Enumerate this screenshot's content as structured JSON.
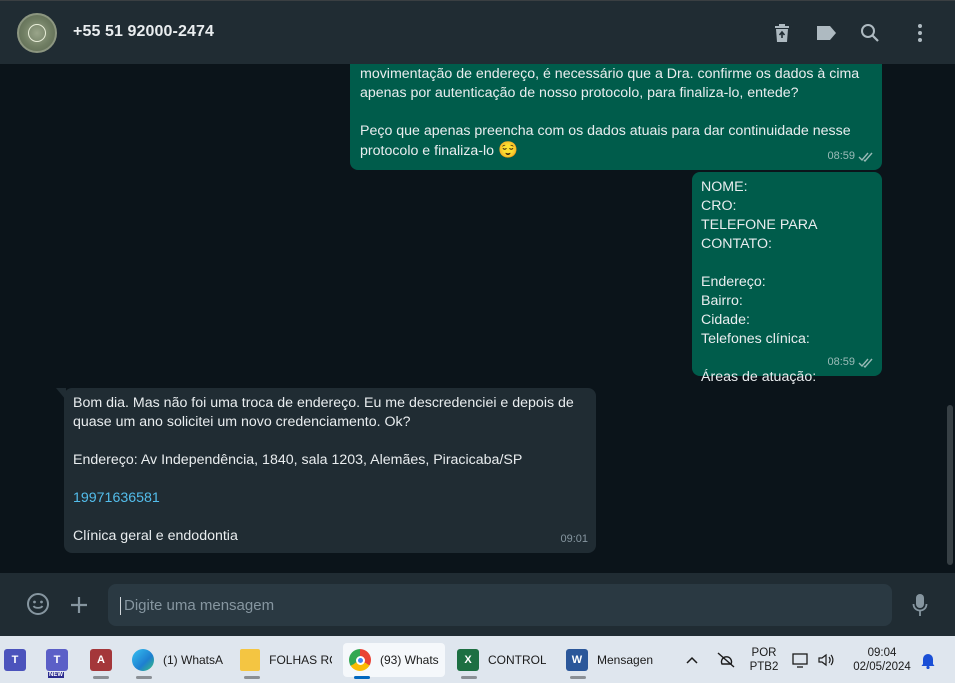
{
  "header": {
    "contact_name": "+55 51 92000-2474",
    "icons": [
      "trash-icon",
      "label-icon",
      "search-icon",
      "more-icon"
    ]
  },
  "messages": [
    {
      "direction": "outgoing",
      "text": "movimentação de endereço, é necessário que a Dra. confirme os dados à cima\napenas por autenticação de nosso protocolo, para finaliza-lo, entede?\n\nPeço que apenas preencha com os dados atuais para dar continuidade nesse\nprotocolo e finaliza-lo",
      "emoji": "😌",
      "time": "08:59",
      "status": "read"
    },
    {
      "direction": "outgoing",
      "text": "NOME:\nCRO:\nTELEFONE PARA CONTATO:\n\nEndereço:\nBairro:\nCidade:\nTelefones clínica:\n\nÁreas de atuação:",
      "time": "08:59",
      "status": "read"
    },
    {
      "direction": "incoming",
      "text_1": "Bom dia. Mas não foi uma troca de endereço. Eu me descredenciei e depois de\nquase um ano solicitei um novo credenciamento. Ok?\n\nEndereço: Av Independência, 1840, sala 1203, Alemães, Piracicaba/SP",
      "phone_link": "19971636581",
      "text_2": "Clínica geral e endodontia",
      "time": "09:01"
    }
  ],
  "composer": {
    "placeholder": "Digite uma mensagem",
    "icons": [
      "emoji-icon",
      "plus-icon",
      "microphone-icon"
    ]
  },
  "taskbar": {
    "apps": [
      {
        "name": "teams-work",
        "label": ""
      },
      {
        "name": "teams-new",
        "label": "",
        "badge": "NEW"
      },
      {
        "name": "access",
        "label": ""
      },
      {
        "name": "edge",
        "label": "(1) WhatsA"
      },
      {
        "name": "explorer",
        "label": "FOLHAS RC"
      },
      {
        "name": "chrome",
        "label": "(93) Whats"
      },
      {
        "name": "excel",
        "label": "CONTROLE"
      },
      {
        "name": "word",
        "label": "Mensagen"
      }
    ],
    "language": "POR",
    "keyboard": "PTB2",
    "time": "09:04",
    "date": "02/05/2024"
  },
  "colors": {
    "outgoing_bubble": "#005c4b",
    "incoming_bubble": "#202c33",
    "chat_bg": "#0b141a",
    "header_bg": "#202c33",
    "link": "#53bdeb"
  }
}
